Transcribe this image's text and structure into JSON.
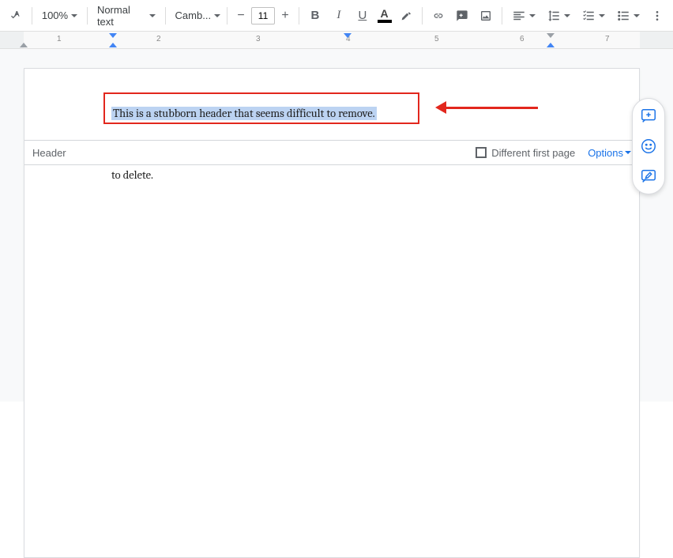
{
  "toolbar": {
    "zoom": "100%",
    "style": "Normal text",
    "font": "Camb...",
    "fontSize": "11",
    "textColorLetter": "A"
  },
  "ruler": {
    "numbers": [
      "1",
      "2",
      "3",
      "4",
      "5",
      "6",
      "7"
    ]
  },
  "document": {
    "headerText": "This is a stubborn header that seems difficult to remove.",
    "bodyFragment": "to delete."
  },
  "headerBar": {
    "label": "Header",
    "differentFirst": "Different first page",
    "options": "Options"
  },
  "colors": {
    "accent": "#1a73e8",
    "annotation": "#e2271d",
    "selection": "#bcd3f2"
  }
}
